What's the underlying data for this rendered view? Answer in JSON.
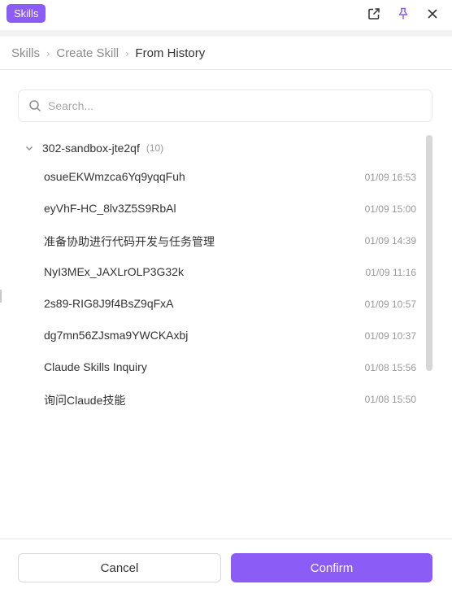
{
  "titlebar": {
    "badge": "Skills",
    "icons": [
      "open-external-icon",
      "pin-icon",
      "close-icon"
    ],
    "accent_color": "#8b5cf6"
  },
  "breadcrumb": {
    "items": [
      "Skills",
      "Create Skill",
      "From History"
    ]
  },
  "search": {
    "placeholder": "Search...",
    "value": ""
  },
  "group": {
    "name": "302-sandbox-jte2qf",
    "count": "(10)",
    "expanded": true
  },
  "rows": [
    {
      "title": "osueEKWmzca6Yq9yqqFuh",
      "time": "01/09 16:53"
    },
    {
      "title": "eyVhF-HC_8lv3Z5S9RbAl",
      "time": "01/09 15:00"
    },
    {
      "title": "准备协助进行代码开发与任务管理",
      "time": "01/09 14:39"
    },
    {
      "title": "NyI3MEx_JAXLrOLP3G32k",
      "time": "01/09 11:16"
    },
    {
      "title": "2s89-RIG8J9f4BsZ9qFxA",
      "time": "01/09 10:57"
    },
    {
      "title": "dg7mn56ZJsma9YWCKAxbj",
      "time": "01/09 10:37"
    },
    {
      "title": "Claude Skills Inquiry",
      "time": "01/08 15:56"
    },
    {
      "title": "询问Claude技能",
      "time": "01/08 15:50"
    }
  ],
  "footer": {
    "cancel_label": "Cancel",
    "confirm_label": "Confirm"
  }
}
